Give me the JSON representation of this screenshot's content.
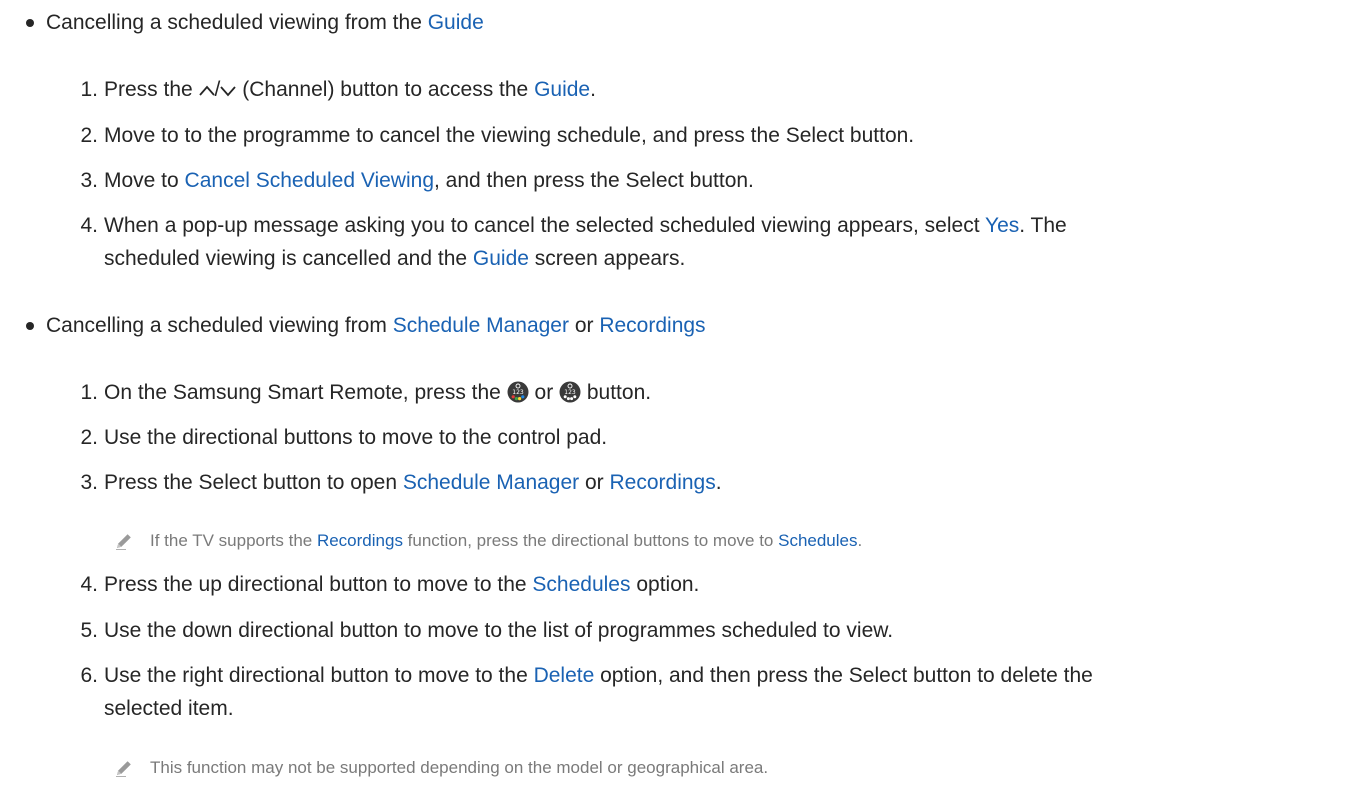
{
  "section1": {
    "heading_prefix": "Cancelling a scheduled viewing from the ",
    "heading_link": "Guide",
    "steps": {
      "s1": {
        "num": "1.",
        "pre": "Press the ",
        "slash": "/",
        "post": " (Channel) button to access the ",
        "link": "Guide",
        "end": "."
      },
      "s2": {
        "num": "2.",
        "text": "Move to to the programme to cancel the viewing schedule, and press the Select button."
      },
      "s3": {
        "num": "3.",
        "pre": "Move to ",
        "link": "Cancel Scheduled Viewing",
        "post": ", and then press the Select button."
      },
      "s4": {
        "num": "4.",
        "pre": "When a pop-up message asking you to cancel the selected scheduled viewing appears, select ",
        "link": "Yes",
        "post": ". The",
        "line2_pre": "scheduled viewing is cancelled and the ",
        "line2_link": "Guide",
        "line2_post": " screen appears."
      }
    }
  },
  "section2": {
    "heading_prefix": "Cancelling a scheduled viewing from ",
    "heading_link1": "Schedule Manager",
    "heading_mid": " or ",
    "heading_link2": "Recordings",
    "steps": {
      "s1": {
        "num": "1.",
        "pre": "On the Samsung Smart Remote, press the ",
        "mid": " or ",
        "post": " button.",
        "button_icon": "123-color-button-icon"
      },
      "s2": {
        "num": "2.",
        "text": "Use the directional buttons to move to the control pad."
      },
      "s3": {
        "num": "3.",
        "pre": "Press the Select button to open ",
        "link1": "Schedule Manager",
        "mid": " or ",
        "link2": "Recordings",
        "end": "."
      },
      "note1": {
        "pre": "If the TV supports the ",
        "link1": "Recordings",
        "mid": " function, press the directional buttons to move to ",
        "link2": "Schedules",
        "end": "."
      },
      "s4": {
        "num": "4.",
        "pre": "Press the up directional button to move to the ",
        "link": "Schedules",
        "post": " option."
      },
      "s5": {
        "num": "5.",
        "text": "Use the down directional button to move to the list of programmes scheduled to view."
      },
      "s6": {
        "num": "6.",
        "pre": "Use the right directional button to move to the ",
        "link": "Delete",
        "post": " option, and then press the Select button to delete the",
        "line2": "selected item."
      },
      "note2": {
        "text": "This function may not be supported depending on the model or geographical area."
      }
    }
  },
  "colors": {
    "link": "#1a62b3",
    "text": "#262626",
    "note": "#7a7a7a"
  }
}
